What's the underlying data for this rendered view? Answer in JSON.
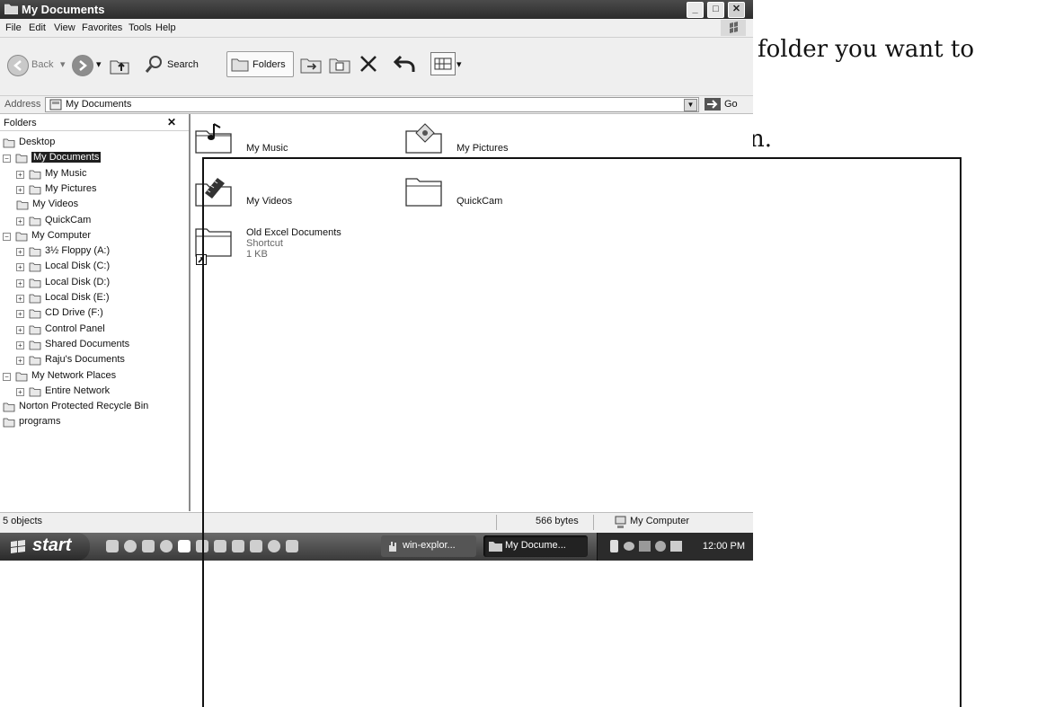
{
  "page_text": {
    "line1_fragment": "folder you want to",
    "line2_fragment": "n."
  },
  "window": {
    "title": "My Documents",
    "caption_buttons": {
      "minimize": "_",
      "maximize": "□",
      "close": "✕"
    }
  },
  "menu": {
    "items": [
      "File",
      "Edit",
      "View",
      "Favorites",
      "Tools",
      "Help"
    ]
  },
  "toolbar": {
    "back_label": "Back",
    "search_label": "Search",
    "folders_label": "Folders"
  },
  "address": {
    "label": "Address",
    "value": "My Documents",
    "go_label": "Go"
  },
  "folders_pane": {
    "title": "Folders",
    "close": "✕",
    "tree": [
      {
        "label": "Desktop",
        "icon": "desktop-icon"
      },
      {
        "label": "My Documents",
        "icon": "documents-icon",
        "expander": "−",
        "selected": true
      },
      {
        "label": "My Music",
        "icon": "music-folder-icon",
        "expander": "+"
      },
      {
        "label": "My Pictures",
        "icon": "pictures-folder-icon",
        "expander": "+"
      },
      {
        "label": "My Videos",
        "icon": "videos-folder-icon"
      },
      {
        "label": "QuickCam",
        "icon": "folder-icon",
        "expander": "+"
      },
      {
        "label": "My Computer",
        "icon": "computer-icon",
        "expander": "−"
      },
      {
        "label": "3½ Floppy (A:)",
        "icon": "floppy-icon",
        "expander": "+"
      },
      {
        "label": "Local Disk (C:)",
        "icon": "disk-icon",
        "expander": "+"
      },
      {
        "label": "Local Disk (D:)",
        "icon": "disk-icon",
        "expander": "+"
      },
      {
        "label": "Local Disk (E:)",
        "icon": "disk-icon",
        "expander": "+"
      },
      {
        "label": "CD Drive (F:)",
        "icon": "cd-drive-icon",
        "expander": "+"
      },
      {
        "label": "Control Panel",
        "icon": "control-panel-icon",
        "expander": "+"
      },
      {
        "label": "Shared Documents",
        "icon": "folder-icon",
        "expander": "+"
      },
      {
        "label": "Raju's Documents",
        "icon": "folder-icon",
        "expander": "+"
      },
      {
        "label": "My Network Places",
        "icon": "network-icon",
        "expander": "−"
      },
      {
        "label": "Entire Network",
        "icon": "globe-icon",
        "expander": "+"
      },
      {
        "label": "Norton Protected Recycle Bin",
        "icon": "recycle-bin-icon"
      },
      {
        "label": "programs",
        "icon": "folder-icon"
      }
    ]
  },
  "content": {
    "items": [
      {
        "name": "My Music",
        "icon": "music-folder-icon"
      },
      {
        "name": "My Pictures",
        "icon": "pictures-folder-icon"
      },
      {
        "name": "My Videos",
        "icon": "videos-folder-icon"
      },
      {
        "name": "QuickCam",
        "icon": "folder-icon"
      },
      {
        "name": "Old Excel Documents",
        "line2": "Shortcut",
        "line3": "1 KB",
        "icon": "shortcut-folder-icon"
      }
    ]
  },
  "status": {
    "objects": "5 objects",
    "size": "566 bytes",
    "location": "My Computer"
  },
  "taskbar": {
    "start_label": "start",
    "tasks": [
      "win-explor...",
      "My Docume..."
    ],
    "clock": "12:00 PM"
  }
}
